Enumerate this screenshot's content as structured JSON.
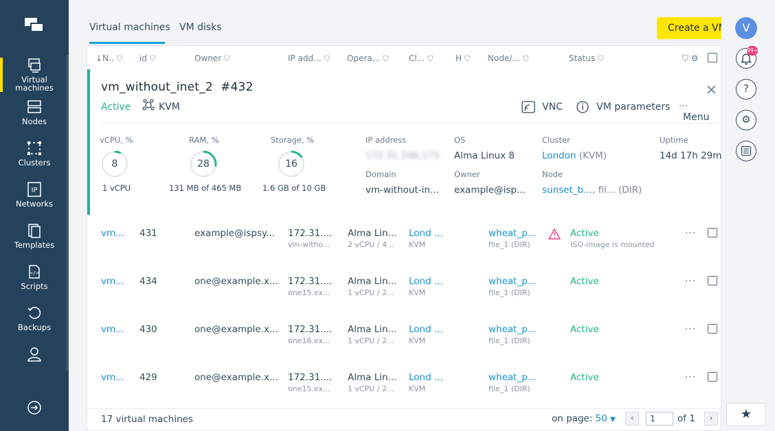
{
  "sidebar": {
    "items": [
      {
        "label_lines": [
          "Virtual",
          "machines"
        ],
        "icon": "virtual-machines-icon",
        "active": true
      },
      {
        "label": "Nodes",
        "icon": "nodes-icon"
      },
      {
        "label": "Clusters",
        "icon": "clusters-icon"
      },
      {
        "label": "Networks",
        "icon": "networks-icon",
        "glyph": "IP"
      },
      {
        "label": "Templates",
        "icon": "templates-icon"
      },
      {
        "label": "Scripts",
        "icon": "scripts-icon"
      },
      {
        "label": "Backups",
        "icon": "backups-icon"
      },
      {
        "label": "",
        "icon": "user-icon"
      }
    ],
    "logout_icon": "logout-icon"
  },
  "tabs": [
    {
      "label": "Virtual machines",
      "active": true
    },
    {
      "label": "VM disks",
      "active": false
    }
  ],
  "create_button": "Create a VM",
  "table": {
    "columns": [
      "↓N..",
      "id",
      "Owner",
      "IP add...",
      "Opera...",
      "Cl...",
      "H",
      "Node/...",
      "Status"
    ],
    "detail": {
      "name": "vm_without_inet_2",
      "id": "#432",
      "status": "Active",
      "hypervisor": "KVM",
      "actions": {
        "vnc": "VNC",
        "params": "VM parameters",
        "menu": "Menu"
      },
      "gauges": [
        {
          "label": "vCPU, %",
          "value": "8",
          "sub": "1 vCPU",
          "fraction": 0.08
        },
        {
          "label": "RAM, %",
          "value": "28",
          "sub": "131 MB of 465 MB",
          "fraction": 0.28
        },
        {
          "label": "Storage, %",
          "value": "16",
          "sub": "1.6 GB of 10 GB",
          "fraction": 0.16
        }
      ],
      "info": {
        "ip_label": "IP address",
        "ip_value": "172.31.246.173",
        "domain_label": "Domain",
        "domain_value": "vm-without-in...",
        "os_label": "OS",
        "os_value": "Alma Linux 8",
        "owner_label": "Owner",
        "owner_value": "example@isp...",
        "cluster_label": "Cluster",
        "cluster_value": "London",
        "cluster_type": "(KVM)",
        "node_label": "Node",
        "node_value": "sunset_b...",
        "node_extra": ", fil...",
        "node_type": "(DIR)",
        "uptime_label": "Uptime",
        "uptime_value": "14d 17h 29m"
      }
    },
    "rows": [
      {
        "name": "vm...",
        "id": "431",
        "owner": "example@ispsy...",
        "ip": "172.31....",
        "ip_sub": "vm-witho...",
        "os": "Alma Lin...",
        "os_sub": "2 vCPU / 4...",
        "cluster": "Lond ...",
        "cluster_sub": "KVM",
        "node": "wheat_p...",
        "node_sub": "file_1 (DIR)",
        "status": "Active",
        "status_sub": "ISO-image is mounted",
        "warning": true
      },
      {
        "name": "vm...",
        "id": "434",
        "owner": "one@example.x...",
        "ip": "172.31....",
        "ip_sub": "one15.ex...",
        "os": "Alma Lin...",
        "os_sub": "1 vCPU / 2...",
        "cluster": "Lond ...",
        "cluster_sub": "KVM",
        "node": "wheat_p...",
        "node_sub": "file_1 (DIR)",
        "status": "Active",
        "status_sub": "",
        "warning": false
      },
      {
        "name": "vm...",
        "id": "430",
        "owner": "one@example.x...",
        "ip": "172.31....",
        "ip_sub": "one16.ex...",
        "os": "Alma Lin...",
        "os_sub": "1 vCPU / 2...",
        "cluster": "Lond ...",
        "cluster_sub": "KVM",
        "node": "wheat_p...",
        "node_sub": "file_1 (DIR)",
        "status": "Active",
        "status_sub": "",
        "warning": false
      },
      {
        "name": "vm...",
        "id": "429",
        "owner": "one@example.x...",
        "ip": "172.31....",
        "ip_sub": "one15.ex...",
        "os": "Alma Lin...",
        "os_sub": "1 vCPU / 2...",
        "cluster": "Lond ...",
        "cluster_sub": "KVM",
        "node": "wheat_p...",
        "node_sub": "file_1 (DIR)",
        "status": "Active",
        "status_sub": "",
        "warning": false
      }
    ]
  },
  "footer": {
    "count_text": "17 virtual machines",
    "on_page_label": "on page:",
    "on_page_value": "50",
    "page_input": "1",
    "page_of": "of 1"
  },
  "right_rail": {
    "avatar_letter": "V",
    "notification_badge": "99+",
    "icons": [
      "bell-icon",
      "help-icon",
      "settings-icon",
      "list-icon"
    ]
  },
  "colors": {
    "sidebar": "#24425c",
    "accent_yellow": "#ffe600",
    "active_green": "#23b38e",
    "link_blue": "#1a8fd1",
    "warning_pink": "#ea3f7c"
  }
}
